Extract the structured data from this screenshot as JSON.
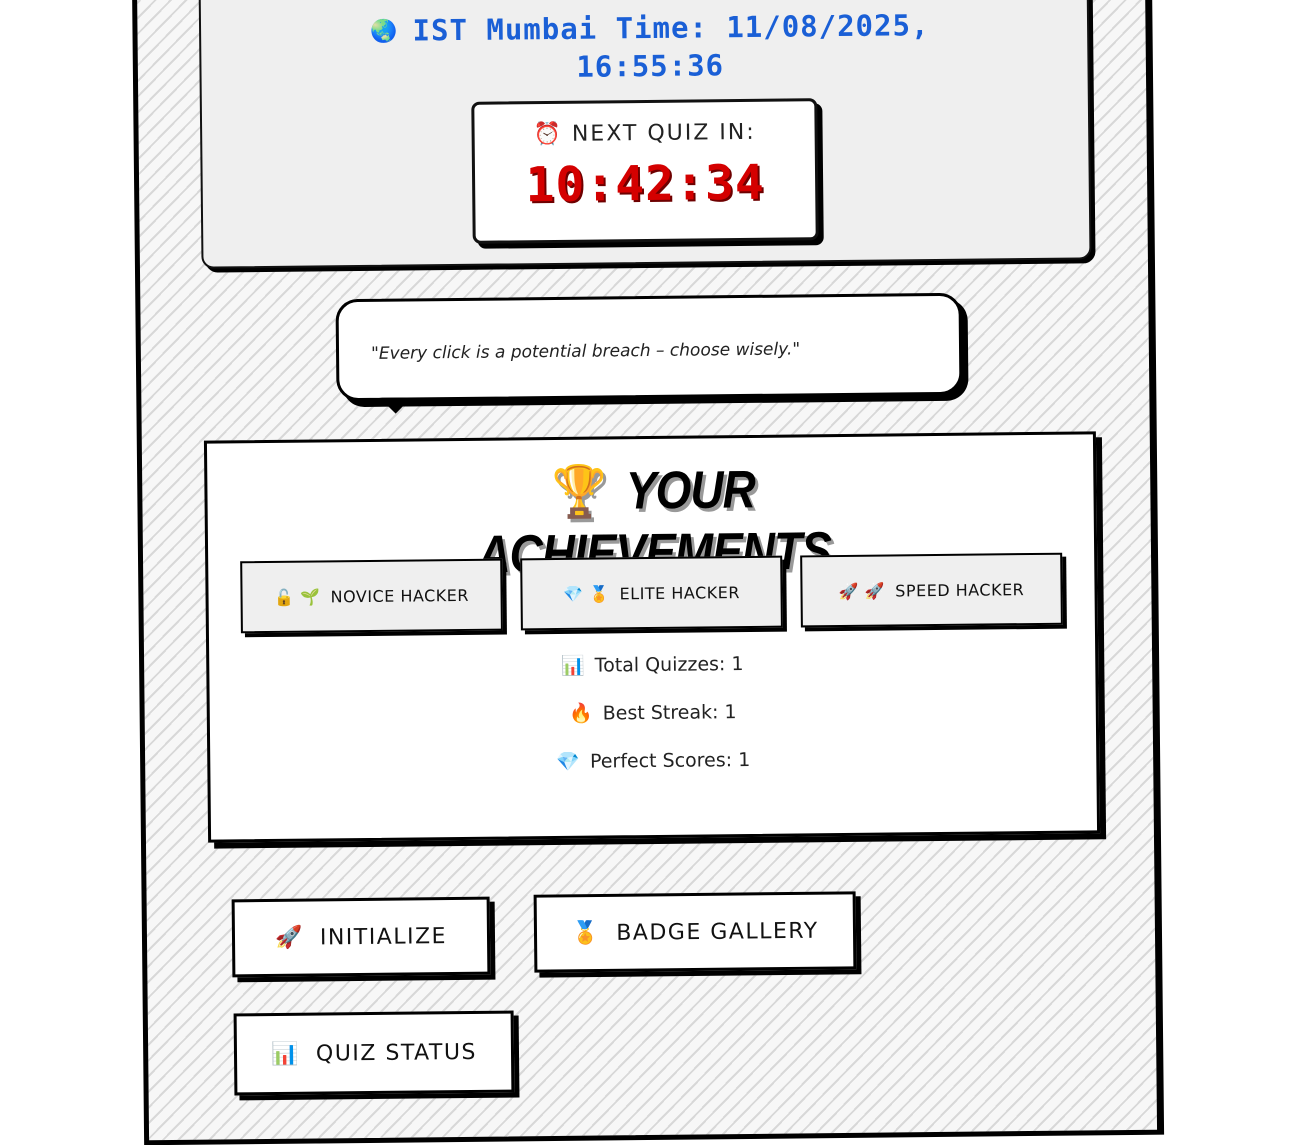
{
  "clock": {
    "globe_icon": "🌏",
    "ist_label": "IST Mumbai Time: 11/08/2025, 16:55:36"
  },
  "next_quiz": {
    "icon": "⏰",
    "label": "NEXT QUIZ IN:",
    "countdown": "10:42:34"
  },
  "quote": {
    "text": "\"Every click is a potential breach – choose wisely.\""
  },
  "achievements": {
    "trophy_icon": "🏆",
    "title": "YOUR ACHIEVEMENTS",
    "badges": [
      {
        "icons": "🔓 🌱",
        "label": "NOVICE HACKER"
      },
      {
        "icons": "💎 🏅",
        "label": "ELITE HACKER"
      },
      {
        "icons": "🚀 🚀",
        "label": "SPEED HACKER"
      }
    ],
    "stats": [
      {
        "icon": "📊",
        "text": "Total Quizzes: 1"
      },
      {
        "icon": "🔥",
        "text": "Best Streak: 1"
      },
      {
        "icon": "💎",
        "text": "Perfect Scores: 1"
      }
    ]
  },
  "actions": {
    "initialize": {
      "icon": "🚀",
      "label": "INITIALIZE"
    },
    "badge_gallery": {
      "icon": "🏅",
      "label": "BADGE GALLERY"
    },
    "quiz_status": {
      "icon": "📊",
      "label": "QUIZ STATUS"
    }
  },
  "colors": {
    "clock_text": "#1a5fd6",
    "countdown": "#d40000",
    "panel_bg": "#efefef"
  }
}
